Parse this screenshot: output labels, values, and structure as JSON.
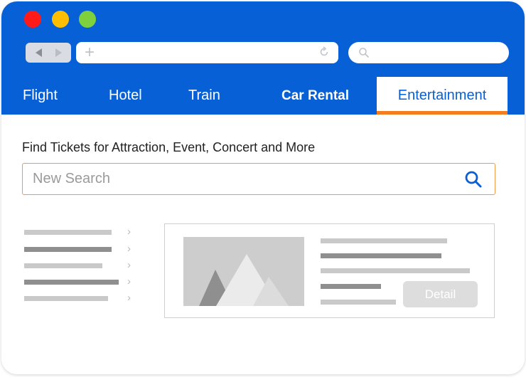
{
  "window": {
    "controls": [
      "close",
      "minimize",
      "maximize"
    ],
    "colors": {
      "close": "#ff1a1a",
      "minimize": "#ffbf00",
      "maximize": "#7ed13c",
      "brand": "#0860d6",
      "accent": "#f47d20"
    }
  },
  "browser": {
    "back_icon": "back-arrow-icon",
    "forward_icon": "forward-arrow-icon",
    "new_tab_glyph": "+",
    "reload_icon": "reload-icon",
    "search_icon": "search-icon"
  },
  "tabs": [
    {
      "label": "Flight",
      "active": false
    },
    {
      "label": "Hotel",
      "active": false
    },
    {
      "label": "Train",
      "active": false
    },
    {
      "label": "Car Rental",
      "active": false
    },
    {
      "label": "Entertainment",
      "active": true
    }
  ],
  "main": {
    "heading": "Find Tickets for Attraction, Event, Concert and More",
    "search": {
      "placeholder": "New Search",
      "value": ""
    }
  },
  "card": {
    "detail_label": "Detail"
  }
}
